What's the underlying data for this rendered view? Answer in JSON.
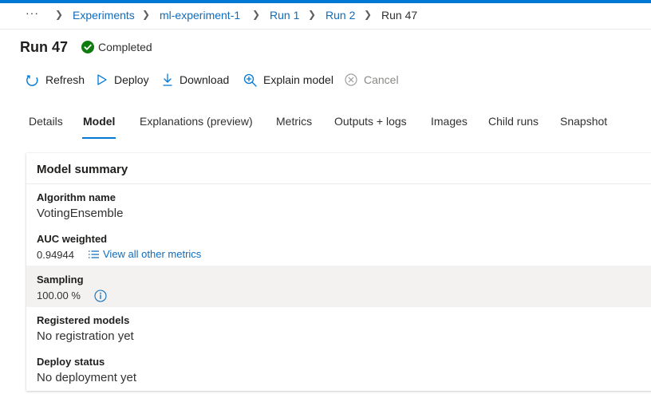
{
  "breadcrumb": {
    "more": "···",
    "items": [
      "Experiments",
      "ml-experiment-1",
      "Run 1",
      "Run 2"
    ],
    "current": "Run 47"
  },
  "header": {
    "title": "Run 47",
    "status": "Completed",
    "status_icon": "check-circle-icon",
    "status_color": "#107c10"
  },
  "commands": [
    {
      "label": "Refresh",
      "icon": "refresh-icon",
      "enabled": true
    },
    {
      "label": "Deploy",
      "icon": "play-icon",
      "enabled": true
    },
    {
      "label": "Download",
      "icon": "download-icon",
      "enabled": true
    },
    {
      "label": "Explain model",
      "icon": "zoom-in-icon",
      "enabled": true
    },
    {
      "label": "Cancel",
      "icon": "cancel-icon",
      "enabled": false
    }
  ],
  "tabs": [
    {
      "label": "Details"
    },
    {
      "label": "Model",
      "active": true
    },
    {
      "label": "Explanations (preview)"
    },
    {
      "label": "Metrics"
    },
    {
      "label": "Outputs + logs"
    },
    {
      "label": "Images"
    },
    {
      "label": "Child runs"
    },
    {
      "label": "Snapshot"
    }
  ],
  "summary": {
    "title": "Model summary",
    "algorithm": {
      "label": "Algorithm name",
      "value": "VotingEnsemble"
    },
    "auc": {
      "label": "AUC weighted",
      "value": "0.94944",
      "link": "View all other metrics"
    },
    "sampling": {
      "label": "Sampling",
      "value": "100.00 %"
    },
    "registered": {
      "label": "Registered models",
      "value": "No registration yet"
    },
    "deploy": {
      "label": "Deploy status",
      "value": "No deployment yet"
    }
  },
  "colors": {
    "accent": "#0078d4",
    "link": "#0f6cbd",
    "success": "#107c10"
  }
}
